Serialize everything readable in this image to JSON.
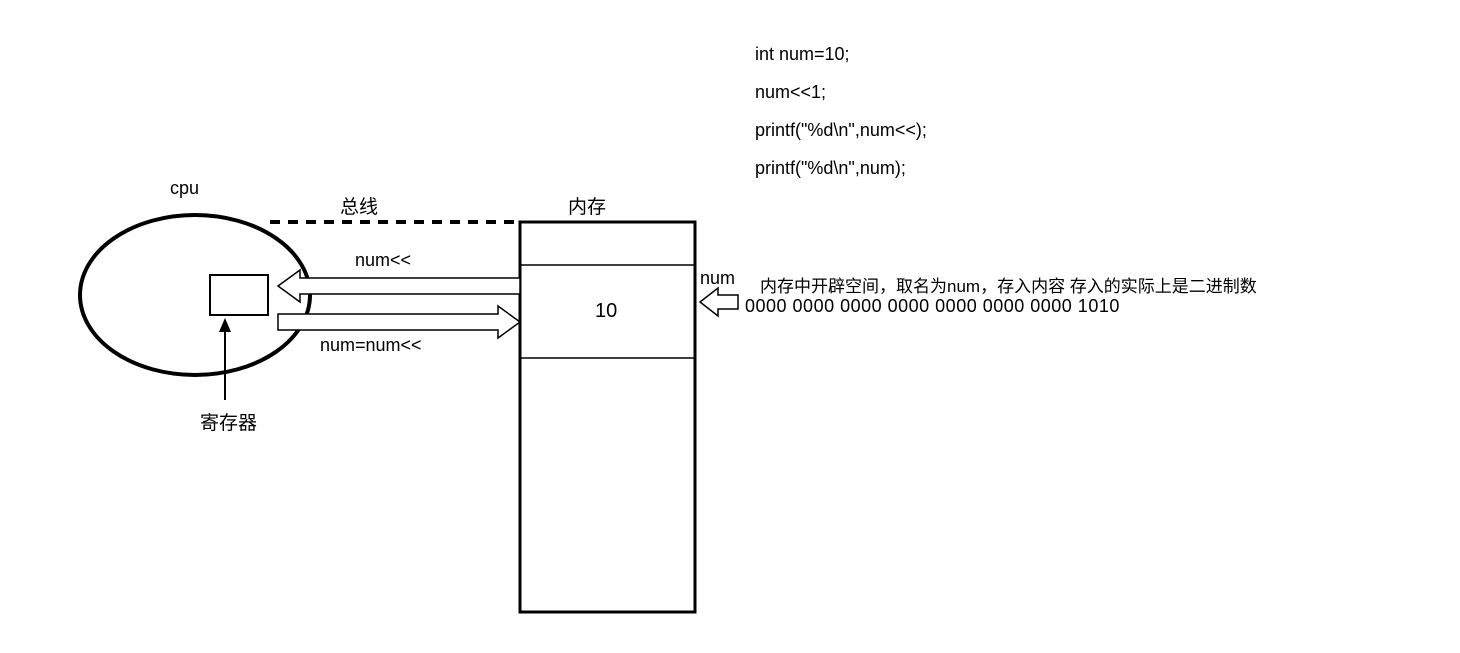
{
  "labels": {
    "cpu": "cpu",
    "bus": "总线",
    "memory": "内存",
    "register": "寄存器",
    "num_var": "num",
    "cell_value": "10",
    "arrow_top_label": "num<<",
    "arrow_bottom_label": "num=num<<"
  },
  "code": {
    "line1": "int num=10;",
    "line2": "num<<1;",
    "line3": "printf(\"%d\\n\",num<<);",
    "line4": "printf(\"%d\\n\",num);"
  },
  "annotation": {
    "desc": "内存中开辟空间，取名为num，存入内容 存入的实际上是二进制数",
    "binary": "0000 0000 0000 0000 0000 0000 0000 1010"
  }
}
